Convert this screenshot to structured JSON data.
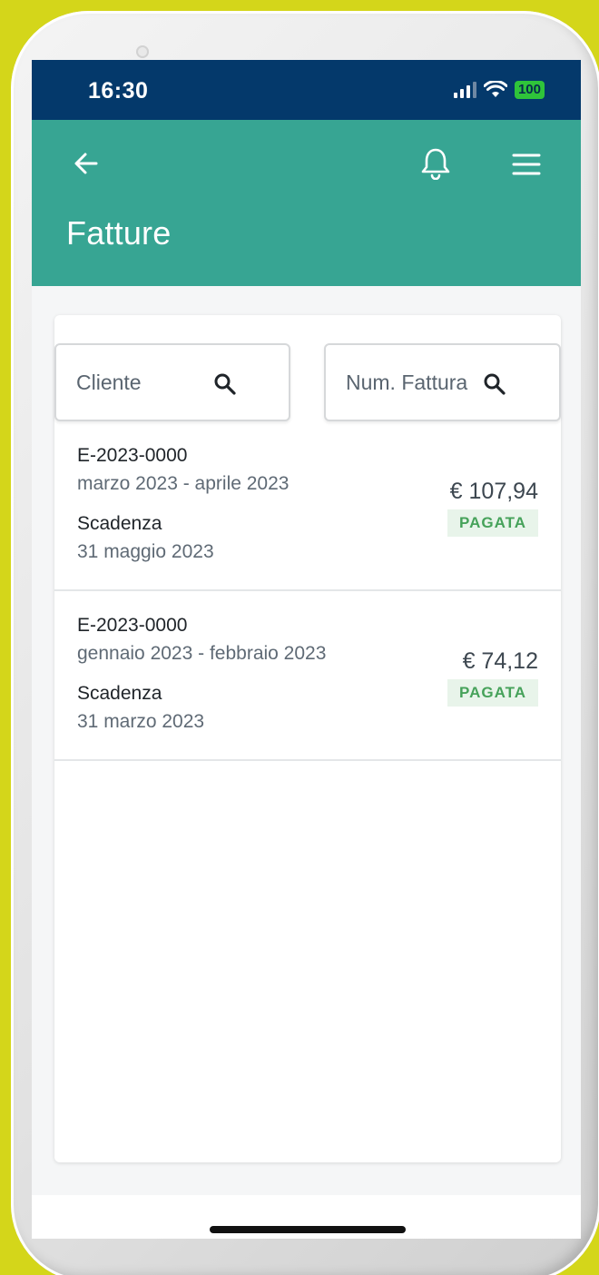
{
  "status_bar": {
    "time": "16:30",
    "battery": "100",
    "signal_icon": "cellular-signal-icon",
    "wifi_icon": "wifi-icon"
  },
  "app_bar": {
    "title": "Fatture",
    "back_icon": "arrow-left-icon",
    "notifications_icon": "bell-icon",
    "menu_icon": "hamburger-menu-icon",
    "color": "#37a593"
  },
  "filters": {
    "cliente_placeholder": "Cliente",
    "numero_placeholder": "Num. Fattura",
    "search_icon": "search-icon"
  },
  "invoices": [
    {
      "number": "E-2023-0000",
      "period": "marzo 2023 - aprile 2023",
      "due_label": "Scadenza",
      "due_date": "31 maggio 2023",
      "amount": "€ 107,94",
      "status": "PAGATA"
    },
    {
      "number": "E-2023-0000",
      "period": "gennaio 2023 - febbraio 2023",
      "due_label": "Scadenza",
      "due_date": "31 marzo 2023",
      "amount": "€ 74,12",
      "status": "PAGATA"
    }
  ],
  "colors": {
    "status_bar": "#04396b",
    "paid_badge_text": "#46a25a",
    "paid_badge_bg": "#e8f4ea"
  }
}
